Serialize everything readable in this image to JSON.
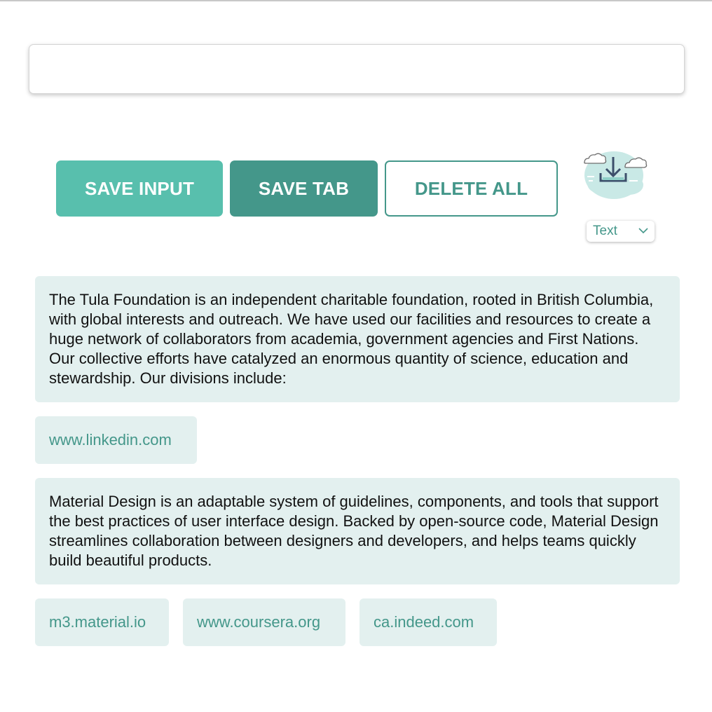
{
  "input": {
    "value": "",
    "placeholder": ""
  },
  "buttons": {
    "save_input": "SAVE INPUT",
    "save_tab": "SAVE TAB",
    "delete_all": "DELETE ALL"
  },
  "export": {
    "icon": "cloud-download-icon",
    "format_selected": "Text"
  },
  "entries": [
    {
      "type": "text",
      "content": "The Tula Foundation is an independent charitable foundation, rooted in British Columbia, with global interests and outreach. We have used our facilities and resources to create a huge network of collaborators from academia, government agencies and First Nations. Our collective efforts have catalyzed an enormous quantity of science, education and stewardship. Our divisions include:"
    },
    {
      "type": "link",
      "content": "www.linkedin.com"
    },
    {
      "type": "text",
      "content": "Material Design is an adaptable system of guidelines, components, and tools that support the best practices of user interface design. Backed by open-source code, Material Design streamlines collaboration between designers and developers, and helps teams quickly build beautiful products."
    },
    {
      "type": "link",
      "content": "m3.material.io"
    },
    {
      "type": "link",
      "content": "www.coursera.org"
    },
    {
      "type": "link",
      "content": "ca.indeed.com"
    }
  ],
  "colors": {
    "primary": "#58bfad",
    "primary_dark": "#44978a",
    "card_background": "#e3f0ef",
    "text": "#111111"
  }
}
